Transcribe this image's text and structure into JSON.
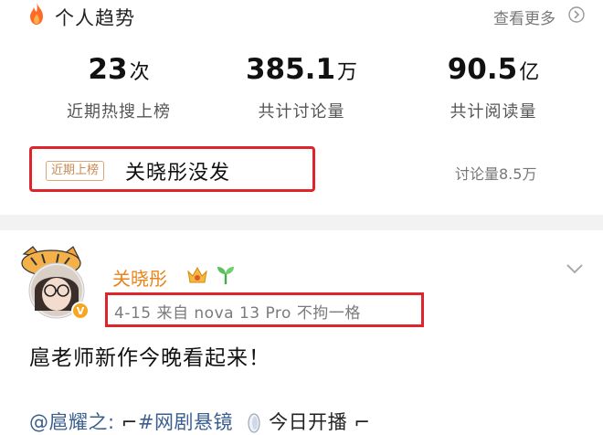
{
  "trend": {
    "title": "个人趋势",
    "see_more": "查看更多",
    "stats": [
      {
        "value": "23",
        "unit": "次",
        "label": "近期热搜上榜"
      },
      {
        "value": "385.1",
        "unit": "万",
        "label": "共计讨论量"
      },
      {
        "value": "90.5",
        "unit": "亿",
        "label": "共计阅读量"
      }
    ],
    "hot": {
      "badge": "近期上榜",
      "topic": "关晓彤没发",
      "discussion": "讨论量8.5万"
    }
  },
  "post": {
    "author": "关晓彤",
    "meta": "4-15  来自 nova 13 Pro 不拘一格",
    "text": "扈老师新作今晚看起来！",
    "mention": "@扈耀之:",
    "bracket_open": "⌐",
    "hashtag": "#网剧悬镜",
    "today": "今日开播",
    "bracket_close": "⌐"
  },
  "colors": {
    "accent_red": "#e0242c",
    "name_orange": "#e8841a",
    "badge_gold": "#c88a52",
    "link_blue": "#3a5f8f"
  },
  "icons": [
    "fire-icon",
    "chevron-right-icon",
    "crown-badge-icon",
    "sprout-badge-icon",
    "verified-badge-icon",
    "chevron-down-icon",
    "moon-icon"
  ]
}
